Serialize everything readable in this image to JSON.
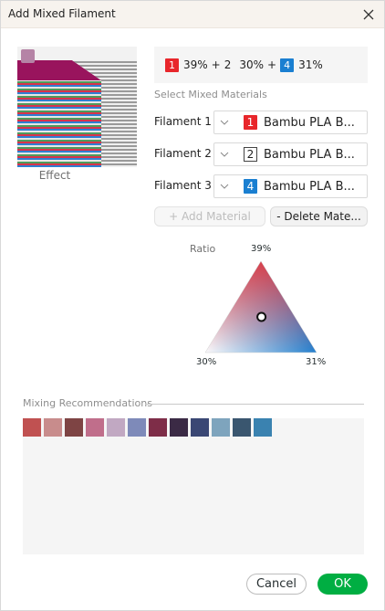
{
  "window": {
    "title": "Add Mixed Filament"
  },
  "icons": {
    "close": "close-icon",
    "dropdown": "chevron-down-icon"
  },
  "preview": {
    "label": "Effect",
    "swatch_color": "#b584a6"
  },
  "formula": {
    "segments": [
      {
        "index": "1",
        "percent": "39%",
        "color": "#e8262b",
        "style": "filled"
      },
      {
        "index": "2",
        "percent": "30%",
        "color": "#ffffff",
        "style": "outline"
      },
      {
        "index": "4",
        "percent": "31%",
        "color": "#1a7fd1",
        "style": "filled"
      }
    ],
    "plus": "+"
  },
  "materials": {
    "section_label": "Select Mixed Materials",
    "rows": [
      {
        "label": "Filament 1",
        "index": "1",
        "name": "Bambu PLA B...",
        "color": "#e8262b",
        "style": "filled"
      },
      {
        "label": "Filament 2",
        "index": "2",
        "name": "Bambu PLA B...",
        "color": "#ffffff",
        "style": "outline"
      },
      {
        "label": "Filament 3",
        "index": "4",
        "name": "Bambu PLA B...",
        "color": "#1a7fd1",
        "style": "filled"
      }
    ],
    "add_label": "+ Add Material",
    "delete_label": "- Delete Mate..."
  },
  "ratio": {
    "label": "Ratio",
    "top_pct": "39%",
    "left_pct": "30%",
    "right_pct": "31%",
    "values": [
      39,
      30,
      31
    ],
    "colors": {
      "top": "#e8262b",
      "left": "#ffffff",
      "right": "#1a7fd1"
    }
  },
  "recommendations": {
    "label": "Mixing Recommendations",
    "swatches": [
      "#c05151",
      "#c88c8c",
      "#7e4444",
      "#c06e8b",
      "#c1a8c2",
      "#7e8ab9",
      "#7e2d48",
      "#3b2a45",
      "#3a4774",
      "#7ea4bd",
      "#3a566f",
      "#3a82b0"
    ]
  },
  "buttons": {
    "cancel": "Cancel",
    "ok": "OK"
  }
}
